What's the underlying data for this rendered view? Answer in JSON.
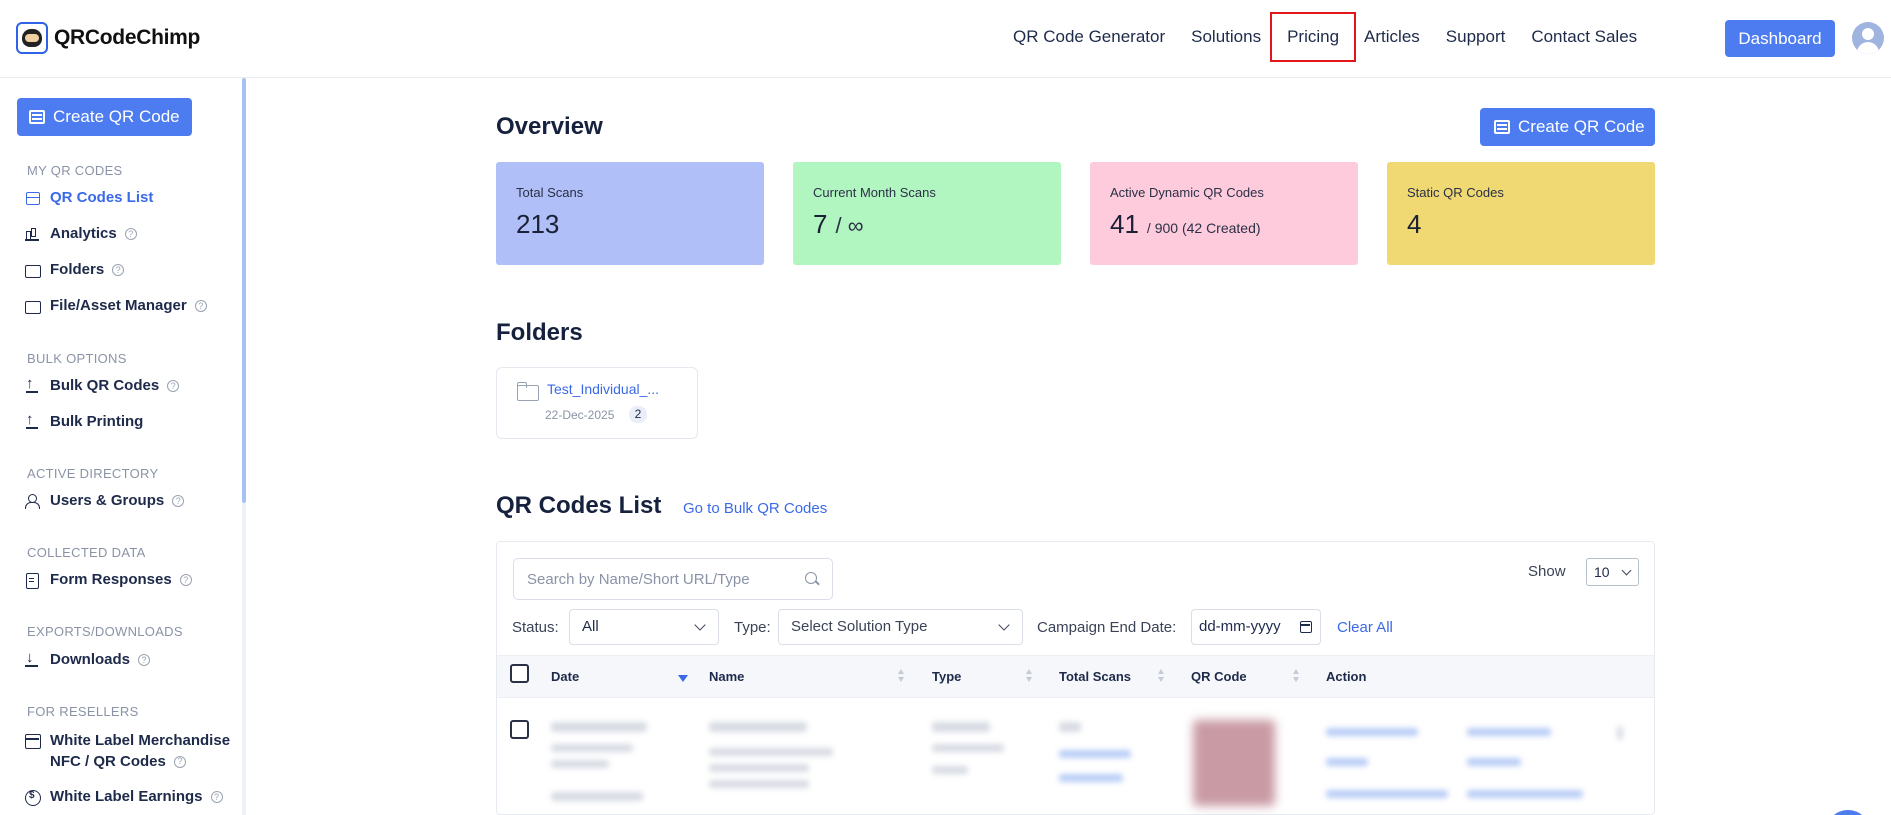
{
  "brand": {
    "name": "QRCodeChimp"
  },
  "nav": {
    "items": [
      "QR Code Generator",
      "Solutions",
      "Pricing",
      "Articles",
      "Support",
      "Contact Sales"
    ],
    "dashboard_label": "Dashboard"
  },
  "sidebar": {
    "create_label": "Create QR Code",
    "sections": {
      "my_qr_codes": "MY QR CODES",
      "bulk_options": "BULK OPTIONS",
      "active_directory": "ACTIVE DIRECTORY",
      "collected_data": "COLLECTED DATA",
      "exports": "EXPORTS/DOWNLOADS",
      "resellers": "FOR RESELLERS"
    },
    "items": {
      "qr_codes_list": "QR Codes List",
      "analytics": "Analytics",
      "folders": "Folders",
      "file_asset_manager": "File/Asset Manager",
      "bulk_qr_codes": "Bulk QR Codes",
      "bulk_printing": "Bulk Printing",
      "users_groups": "Users & Groups",
      "form_responses": "Form Responses",
      "downloads": "Downloads",
      "white_label_merch_1": "White Label Merchandise",
      "white_label_merch_2": "NFC / QR Codes",
      "white_label_earnings": "White Label Earnings"
    },
    "help_glyph": "?"
  },
  "overview": {
    "title": "Overview",
    "create_label": "Create QR Code",
    "cards": [
      {
        "label": "Total Scans",
        "value": "213",
        "sub": "",
        "color": "#b0bff7"
      },
      {
        "label": "Current Month Scans",
        "value": "7",
        "sub": "/ ∞",
        "color": "#b1f5c0"
      },
      {
        "label": "Active Dynamic QR Codes",
        "value": "41",
        "sub": "/ 900 (42 Created)",
        "color": "#fecbdc"
      },
      {
        "label": "Static QR Codes",
        "value": "4",
        "sub": "",
        "color": "#f0d873"
      }
    ]
  },
  "folders": {
    "title": "Folders",
    "items": [
      {
        "name": "Test_Individual_...",
        "date": "22-Dec-2025",
        "count": "2"
      }
    ]
  },
  "qr_list": {
    "title": "QR Codes List",
    "bulk_link": "Go to Bulk QR Codes",
    "search_placeholder": "Search by Name/Short URL/Type",
    "show_label": "Show",
    "show_value": "10",
    "status_label": "Status:",
    "status_value": "All",
    "type_label": "Type:",
    "type_value": "Select Solution Type",
    "campaign_label": "Campaign End Date:",
    "campaign_value": "dd-mm-yyyy",
    "clear_all": "Clear All",
    "columns": [
      "Date",
      "Name",
      "Type",
      "Total Scans",
      "QR Code",
      "Action"
    ]
  },
  "colors": {
    "accent": "#4c7cf0",
    "link": "#3b6ae8",
    "highlight_box": "#e0161b"
  }
}
